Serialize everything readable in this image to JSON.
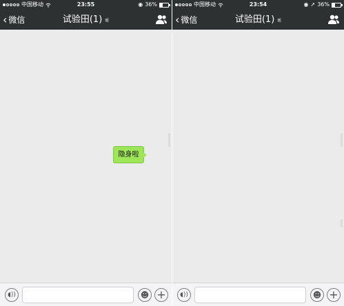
{
  "screens": [
    {
      "status": {
        "carrier": "中国移动",
        "time": "23:55",
        "battery": "36%",
        "battery_level": 0.36
      },
      "nav": {
        "back_label": "微信",
        "title": "试验田(1)"
      },
      "messages": [
        {
          "text": "隐身啦",
          "sender": "self"
        }
      ]
    },
    {
      "status": {
        "carrier": "中国移动",
        "time": "23:54",
        "battery": "36%",
        "battery_level": 0.36
      },
      "nav": {
        "back_label": "微信",
        "title": "试验田(1)"
      },
      "messages": []
    }
  ],
  "icons": {
    "back": "chevron-left-icon",
    "mute": "bell-mute-icon",
    "members": "group-members-icon",
    "voice": "voice-icon",
    "emoji": "emoji-icon",
    "more": "plus-icon"
  },
  "colors": {
    "bar_background": "#2e3132",
    "chat_background": "#ebebeb",
    "bubble_self": "#9fe55a"
  }
}
